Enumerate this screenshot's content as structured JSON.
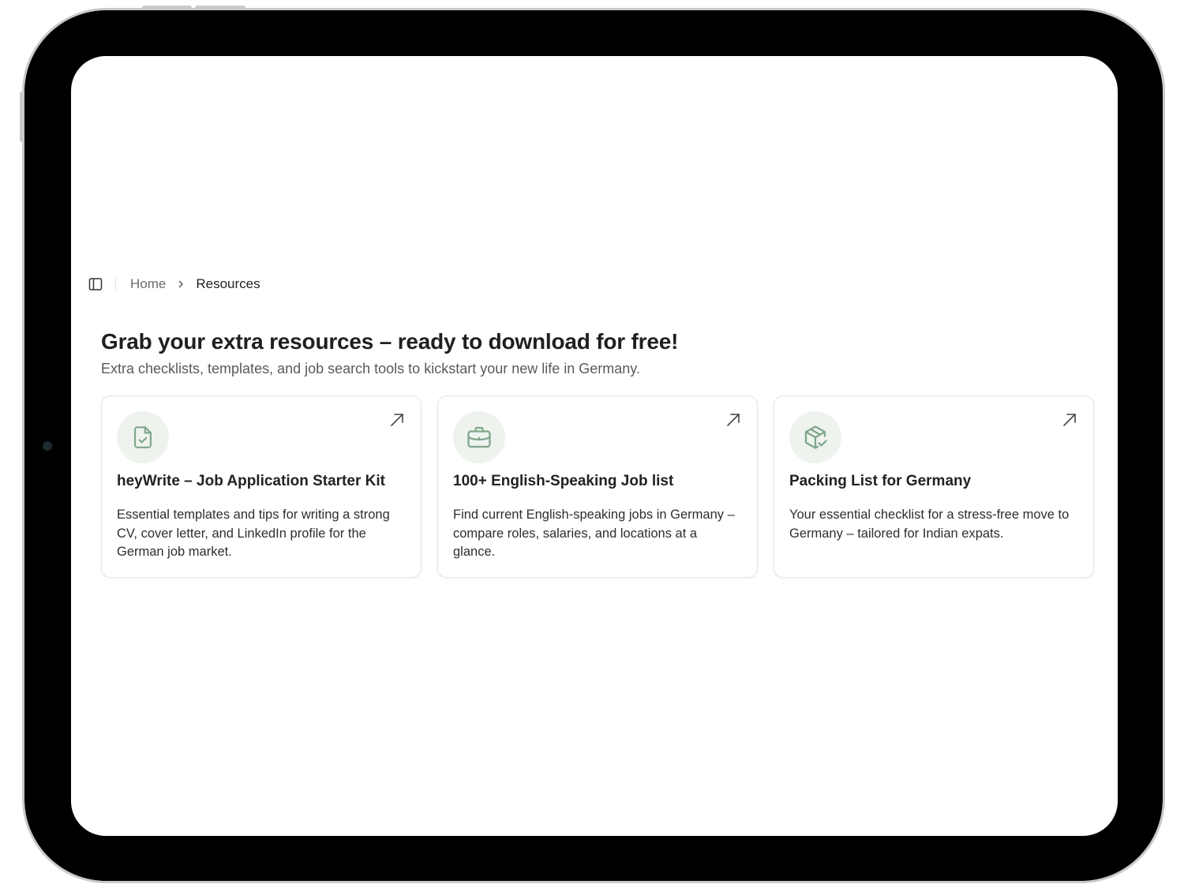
{
  "breadcrumb": {
    "items": [
      {
        "label": "Home"
      },
      {
        "label": "Resources"
      }
    ]
  },
  "header": {
    "title": "Grab your extra resources – ready to download for free!",
    "subtitle": "Extra checklists, templates, and job search tools to kickstart your new life in Germany."
  },
  "cards": [
    {
      "icon": "document-check-icon",
      "title": "heyWrite – Job Application Starter Kit",
      "description": "Essential templates and tips for writing a strong CV, cover letter, and LinkedIn profile for the German job market."
    },
    {
      "icon": "briefcase-icon",
      "title": "100+ English-Speaking Job list",
      "description": "Find current English-speaking jobs in Germany – compare roles, salaries, and locations at a glance."
    },
    {
      "icon": "package-check-icon",
      "title": "Packing List for Germany",
      "description": "Your essential checklist for a stress-free move to Germany – tailored for Indian expats."
    }
  ],
  "colors": {
    "icon_green": "#7fa58a",
    "icon_bg": "#eef3ee",
    "text_primary": "#1f1f1f",
    "text_muted": "#5a5a5a"
  }
}
